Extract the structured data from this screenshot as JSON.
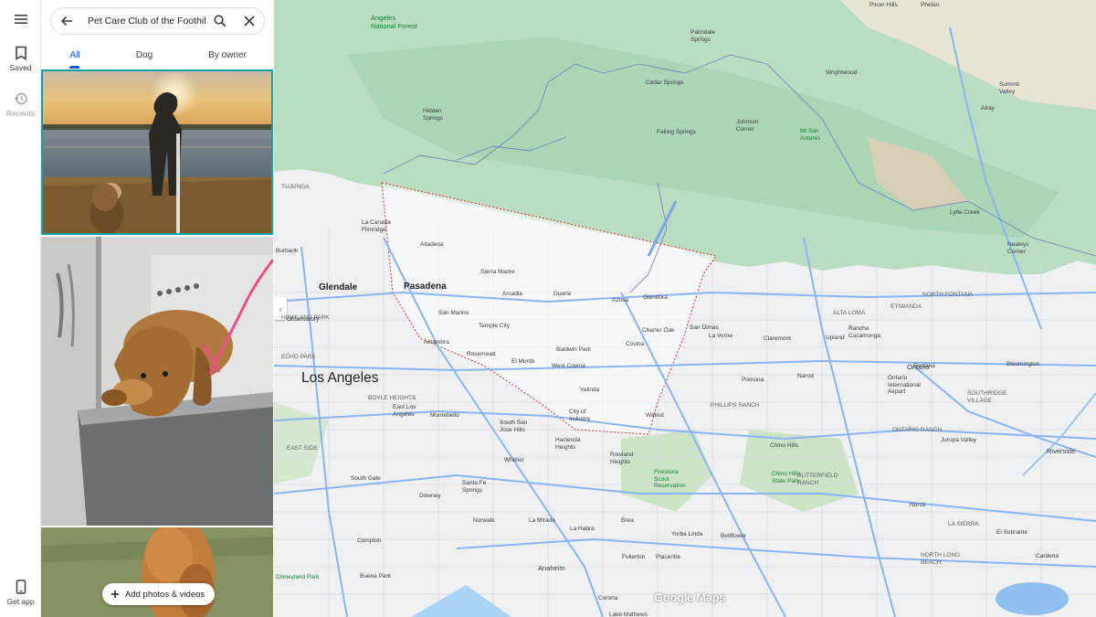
{
  "rail": {
    "saved_label": "Saved",
    "recents_label": "Recents",
    "getapp_label": "Get app"
  },
  "search": {
    "query": "Pet Care Club of the Foothills"
  },
  "tabs": [
    {
      "label": "All",
      "active": true
    },
    {
      "label": "Dog",
      "active": false
    },
    {
      "label": "By owner",
      "active": false
    }
  ],
  "add_button_label": "Add photos & videos",
  "map": {
    "attribution": "Google Maps",
    "labels": [
      {
        "text": "Pinon Hills",
        "cls": "m-sm"
      },
      {
        "text": "Phelan",
        "cls": "m-sm"
      },
      {
        "text": "Angeles\nNational Forest",
        "cls": "m-md m-green"
      },
      {
        "text": "Palmdale\nSprings",
        "cls": "m-sm"
      },
      {
        "text": "Wrightwood",
        "cls": "m-sm"
      },
      {
        "text": "Summit\nValley",
        "cls": "m-sm"
      },
      {
        "text": "Cedar Springs",
        "cls": "m-sm"
      },
      {
        "text": "Hidden\nSprings",
        "cls": "m-sm"
      },
      {
        "text": "Johnson\nCorner",
        "cls": "m-sm"
      },
      {
        "text": "Falling Springs",
        "cls": "m-sm"
      },
      {
        "text": "Mt San\nAntonio",
        "cls": "m-sm m-green"
      },
      {
        "text": "Alray",
        "cls": "m-sm"
      },
      {
        "text": "Lytle Creek",
        "cls": "m-sm"
      },
      {
        "text": "Nealeys\nCorner",
        "cls": "m-sm"
      },
      {
        "text": "TUJUNGA",
        "cls": "m-sm m-gray"
      },
      {
        "text": "La Canada\nFlintridge",
        "cls": "m-sm"
      },
      {
        "text": "Altadena",
        "cls": "m-sm"
      },
      {
        "text": "Burbank",
        "cls": "m-sm"
      },
      {
        "text": "Sierra Madre",
        "cls": "m-sm"
      },
      {
        "text": "Glendale",
        "cls": "m-lg"
      },
      {
        "text": "Pasadena",
        "cls": "m-lg"
      },
      {
        "text": "Arcadia",
        "cls": "m-sm"
      },
      {
        "text": "Duarte",
        "cls": "m-sm"
      },
      {
        "text": "Azusa",
        "cls": "m-sm"
      },
      {
        "text": "Glendora",
        "cls": "m-sm"
      },
      {
        "text": "ALTA LOMA",
        "cls": "m-sm m-gray"
      },
      {
        "text": "NORTH FONTANA",
        "cls": "m-sm m-gray"
      },
      {
        "text": "La Verne",
        "cls": "m-sm"
      },
      {
        "text": "Claremont",
        "cls": "m-sm"
      },
      {
        "text": "Upland",
        "cls": "m-sm"
      },
      {
        "text": "Rancho\nCucamonga",
        "cls": "m-sm"
      },
      {
        "text": "ETIWANDA",
        "cls": "m-sm m-gray"
      },
      {
        "text": "HIGHLAND PARK",
        "cls": "m-sm m-gray"
      },
      {
        "text": "San Marino",
        "cls": "m-sm"
      },
      {
        "text": "Temple City",
        "cls": "m-sm"
      },
      {
        "text": "Charter Oak",
        "cls": "m-sm"
      },
      {
        "text": "San Dimas",
        "cls": "m-sm"
      },
      {
        "text": "Observatory",
        "cls": "m-sm"
      },
      {
        "text": "ECHO PARK",
        "cls": "m-sm m-gray"
      },
      {
        "text": "Alhambra",
        "cls": "m-sm"
      },
      {
        "text": "Rosemead",
        "cls": "m-sm"
      },
      {
        "text": "Baldwin Park",
        "cls": "m-sm"
      },
      {
        "text": "Covina",
        "cls": "m-sm"
      },
      {
        "text": "Los Angeles",
        "cls": "m-xl"
      },
      {
        "text": "El Monte",
        "cls": "m-sm"
      },
      {
        "text": "West Covina",
        "cls": "m-sm"
      },
      {
        "text": "Pomona",
        "cls": "m-sm"
      },
      {
        "text": "Narod",
        "cls": "m-sm"
      },
      {
        "text": "Ontario\nInternational\nAirport",
        "cls": "m-sm"
      },
      {
        "text": "Ontario",
        "cls": "m-md"
      },
      {
        "text": "Bloomington",
        "cls": "m-sm"
      },
      {
        "text": "BOYLE HEIGHTS",
        "cls": "m-sm m-gray"
      },
      {
        "text": "Valinda",
        "cls": "m-sm"
      },
      {
        "text": "Fontana",
        "cls": "m-sm"
      },
      {
        "text": "East Los\nAngeles",
        "cls": "m-sm"
      },
      {
        "text": "Montebello",
        "cls": "m-sm"
      },
      {
        "text": "City of\nIndustry",
        "cls": "m-sm"
      },
      {
        "text": "Walnut",
        "cls": "m-sm"
      },
      {
        "text": "PHILLIPS RANCH",
        "cls": "m-sm m-gray"
      },
      {
        "text": "SOUTHRIDGE\nVILLAGE",
        "cls": "m-sm m-gray"
      },
      {
        "text": "South San\nJose Hills",
        "cls": "m-sm"
      },
      {
        "text": "ONTARIO RANCH",
        "cls": "m-sm m-gray"
      },
      {
        "text": "EAST SIDE",
        "cls": "m-sm m-gray"
      },
      {
        "text": "Jurupa Valley",
        "cls": "m-sm"
      },
      {
        "text": "Hacienda\nHeights",
        "cls": "m-sm"
      },
      {
        "text": "Chino Hills",
        "cls": "m-sm"
      },
      {
        "text": "Riverside",
        "cls": "m-md"
      },
      {
        "text": "Whittier",
        "cls": "m-sm"
      },
      {
        "text": "Rowland\nHeights",
        "cls": "m-sm"
      },
      {
        "text": "South Gate",
        "cls": "m-sm"
      },
      {
        "text": "Santa Fe\nSprings",
        "cls": "m-sm"
      },
      {
        "text": "Firestone\nScout\nReservation",
        "cls": "m-sm m-green"
      },
      {
        "text": "Chino Hills\nState Park",
        "cls": "m-sm m-green"
      },
      {
        "text": "BUTTERFIELD\nRANCH",
        "cls": "m-sm m-gray"
      },
      {
        "text": "Norco",
        "cls": "m-sm"
      },
      {
        "text": "LA SIERRA",
        "cls": "m-sm m-gray"
      },
      {
        "text": "Downey",
        "cls": "m-sm"
      },
      {
        "text": "Compton",
        "cls": "m-sm"
      },
      {
        "text": "Norwalk",
        "cls": "m-sm"
      },
      {
        "text": "La Mirada",
        "cls": "m-sm"
      },
      {
        "text": "La Habra",
        "cls": "m-sm"
      },
      {
        "text": "Brea",
        "cls": "m-sm"
      },
      {
        "text": "Yorba Linda",
        "cls": "m-sm"
      },
      {
        "text": "Bellflower",
        "cls": "m-sm"
      },
      {
        "text": "Fullerton",
        "cls": "m-sm"
      },
      {
        "text": "Placentia",
        "cls": "m-sm"
      },
      {
        "text": "NORTH LONG\nBEACH",
        "cls": "m-sm m-gray"
      },
      {
        "text": "Buena Park",
        "cls": "m-sm"
      },
      {
        "text": "Anaheim",
        "cls": "m-md"
      },
      {
        "text": "Corona",
        "cls": "m-sm"
      },
      {
        "text": "El Sobrante",
        "cls": "m-sm"
      },
      {
        "text": "Cardena",
        "cls": "m-sm"
      },
      {
        "text": "Disneyland Park",
        "cls": "m-sm m-green"
      },
      {
        "text": "Lake Mathews",
        "cls": "m-sm"
      }
    ]
  }
}
